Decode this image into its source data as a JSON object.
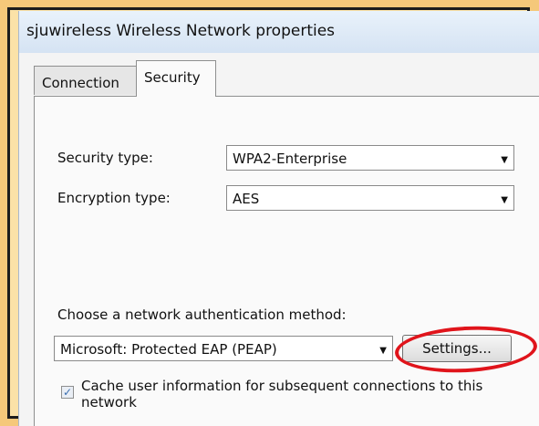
{
  "window": {
    "title": "sjuwireless Wireless Network properties"
  },
  "tabs": [
    {
      "label": "Connection",
      "active": false
    },
    {
      "label": "Security",
      "active": true
    }
  ],
  "security": {
    "security_type_label": "Security type:",
    "security_type_value": "WPA2-Enterprise",
    "encryption_type_label": "Encryption type:",
    "encryption_type_value": "AES",
    "auth_method_label": "Choose a network authentication method:",
    "auth_method_value": "Microsoft: Protected EAP (PEAP)",
    "settings_label": "Settings...",
    "cache_checked": true,
    "cache_label": "Cache user information for subsequent connections to this network"
  },
  "icons": {
    "dropdown_arrow": "▼",
    "checkmark": "✓"
  },
  "colors": {
    "background": "#f5c87a",
    "highlight": "#e0141b"
  }
}
